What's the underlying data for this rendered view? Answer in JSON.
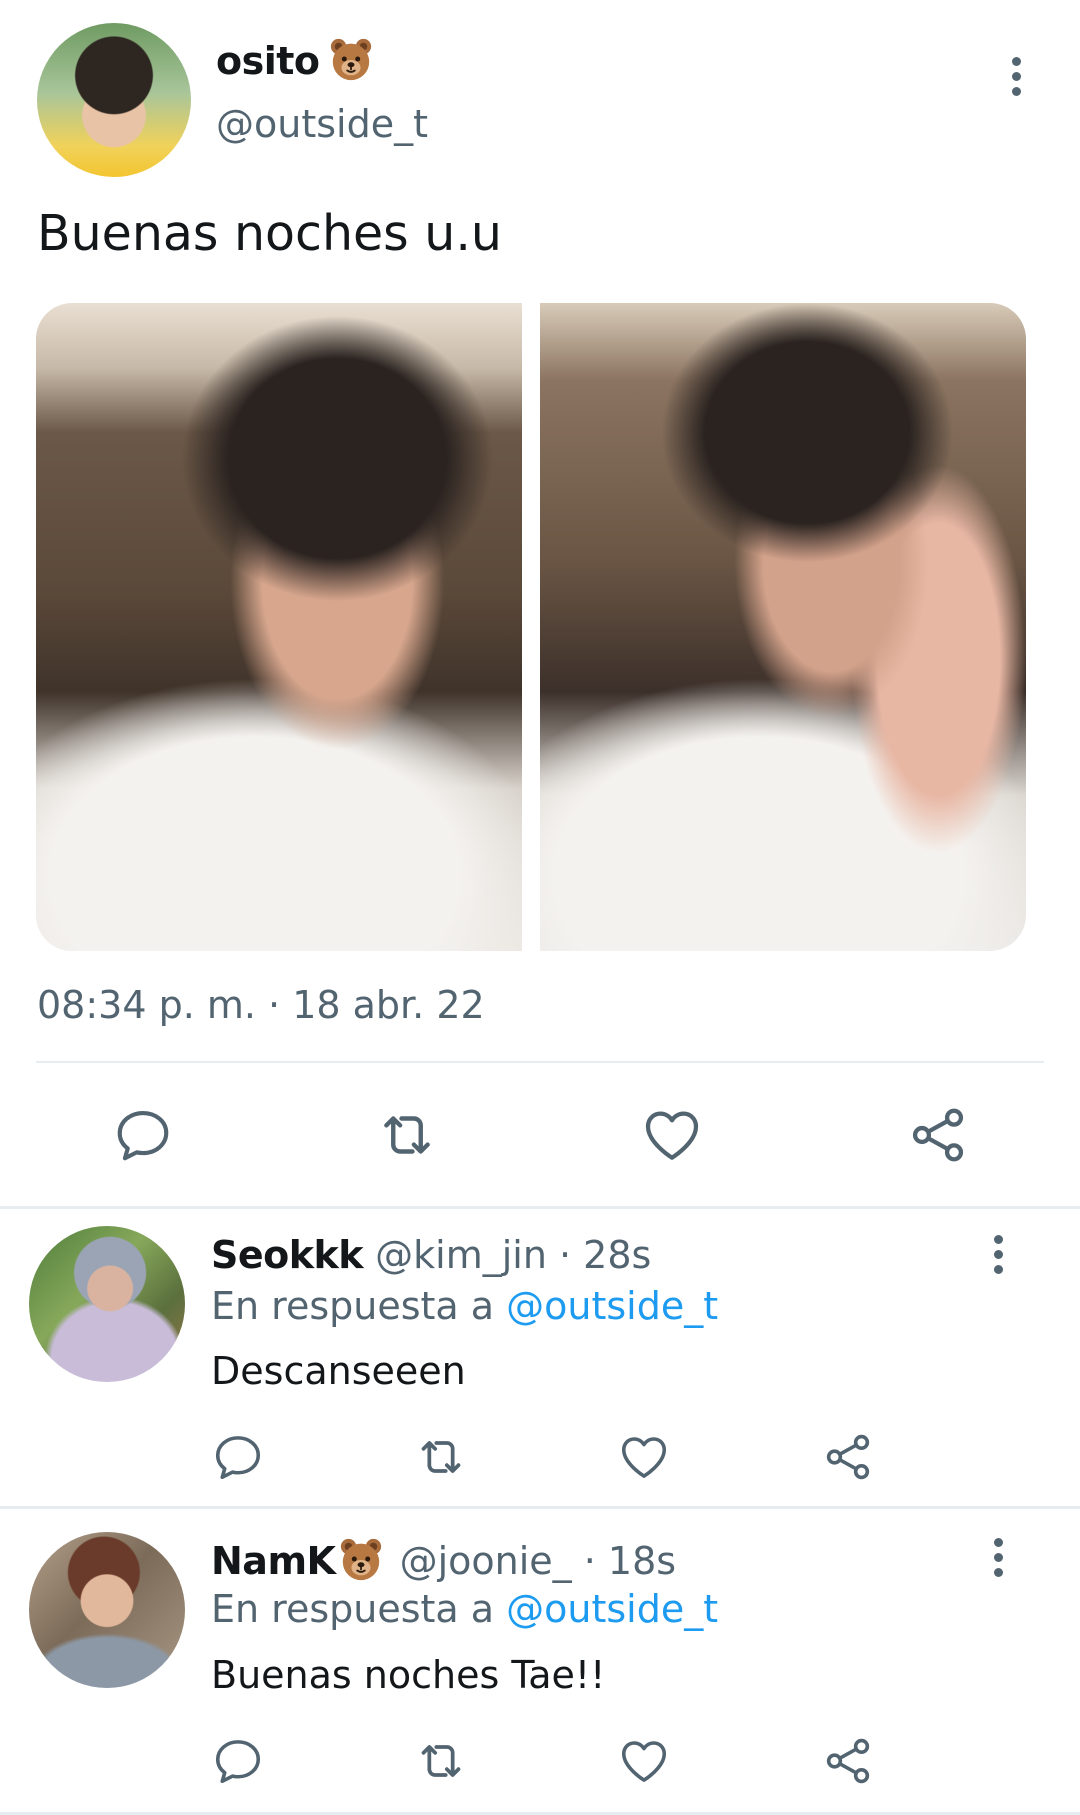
{
  "tweet": {
    "author_name": "osito",
    "author_emoji": "bear-face-emoji",
    "author_handle": "@outside_t",
    "text": "Buenas noches u.u",
    "timestamp": "08:34 p. m. · 18 abr. 22",
    "photos": [
      "photo-1",
      "photo-2"
    ]
  },
  "actions": [
    "reply-icon",
    "retweet-icon",
    "like-icon",
    "share-icon"
  ],
  "replies": [
    {
      "name": "Seokkk",
      "handle": "@kim_jin",
      "time": " · 28s",
      "reply_prefix": "En respuesta a ",
      "reply_mention": "@outside_t",
      "text": "Descanseeen"
    },
    {
      "name": "NamK",
      "name_emoji": "bear-face-emoji",
      "handle": "@joonie_",
      "time": " · 18s",
      "reply_prefix": "En respuesta a ",
      "reply_mention": "@outside_t",
      "text": "Buenas noches Tae!!"
    }
  ],
  "colors": {
    "text": "#14171a",
    "secondary": "#536471",
    "accent": "#1d9bf0",
    "divider": "#e6ecf0"
  }
}
